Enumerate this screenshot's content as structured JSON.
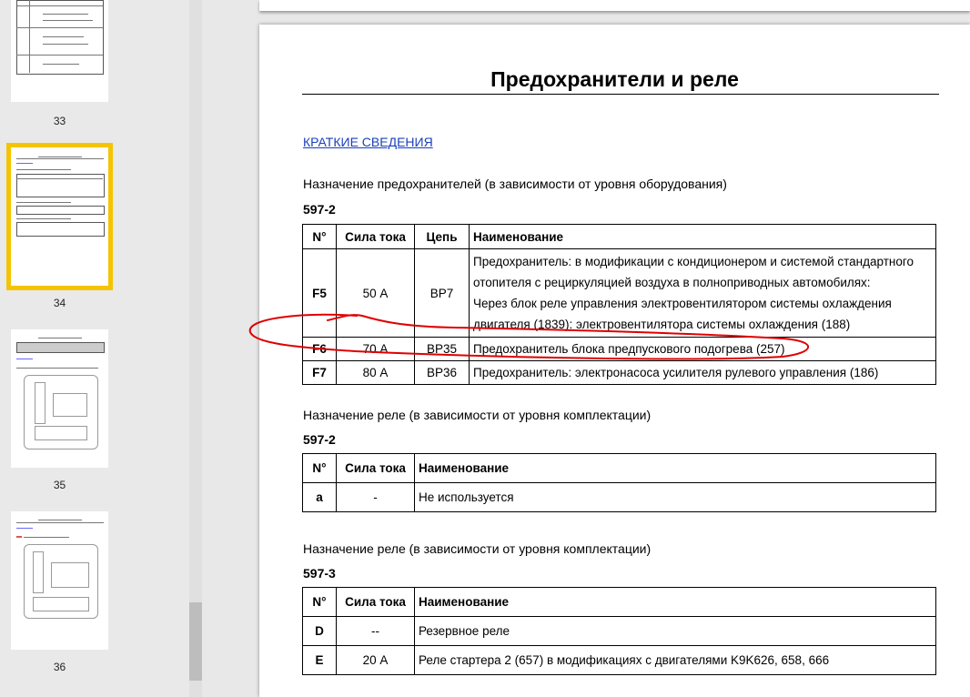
{
  "sidebar": {
    "pages": [
      {
        "number": "33"
      },
      {
        "number": "34",
        "selected": true
      },
      {
        "number": "35"
      },
      {
        "number": "36"
      }
    ]
  },
  "doc": {
    "title": "Предохранители и реле",
    "link": "КРАТКИЕ СВЕДЕНИЯ",
    "fuses_heading": "Назначение предохранителей (в зависимости от уровня оборудования)",
    "fuses_code": "597-2",
    "fuses_table": {
      "headers": [
        "N°",
        "Сила тока",
        "Цепь",
        "Наименование"
      ],
      "rows": [
        {
          "n": "F5",
          "amp": "50 А",
          "circuit": "BP7",
          "lines": [
            "Предохранитель: в модификации с кондиционером и системой стандартного",
            "отопителя с рециркуляцией воздуха в полноприводных автомобилях:",
            "Через блок реле управления электровентилятором системы охлаждения",
            "двигателя (1839): электровентилятора системы охлаждения (188)"
          ]
        },
        {
          "n": "F6",
          "amp": "70 А",
          "circuit": "BP35",
          "name": "Предохранитель блока предпускового подогрева (257)"
        },
        {
          "n": "F7",
          "amp": "80 А",
          "circuit": "BP36",
          "name": "Предохранитель: электронасоса усилителя рулевого управления (186)"
        }
      ]
    },
    "relays1_heading": "Назначение реле (в зависимости от уровня комплектации)",
    "relays1_code": "597-2",
    "relays1_table": {
      "headers": [
        "N°",
        "Сила тока",
        "Наименование"
      ],
      "rows": [
        {
          "n": "a",
          "amp": "-",
          "name": "Не используется"
        }
      ]
    },
    "relays2_heading": "Назначение реле (в зависимости от уровня комплектации)",
    "relays2_code": "597-3",
    "relays2_table": {
      "headers": [
        "N°",
        "Сила тока",
        "Наименование"
      ],
      "rows": [
        {
          "n": "D",
          "amp": "--",
          "name": "Резервное реле"
        },
        {
          "n": "E",
          "amp": "20 А",
          "name": "Реле стартера 2 (657) в модификациях с двигателями K9K626, 658, 666"
        }
      ]
    }
  },
  "colors": {
    "accent": "#f5c400",
    "link": "#1a3fc0",
    "annotation": "#e00000"
  }
}
